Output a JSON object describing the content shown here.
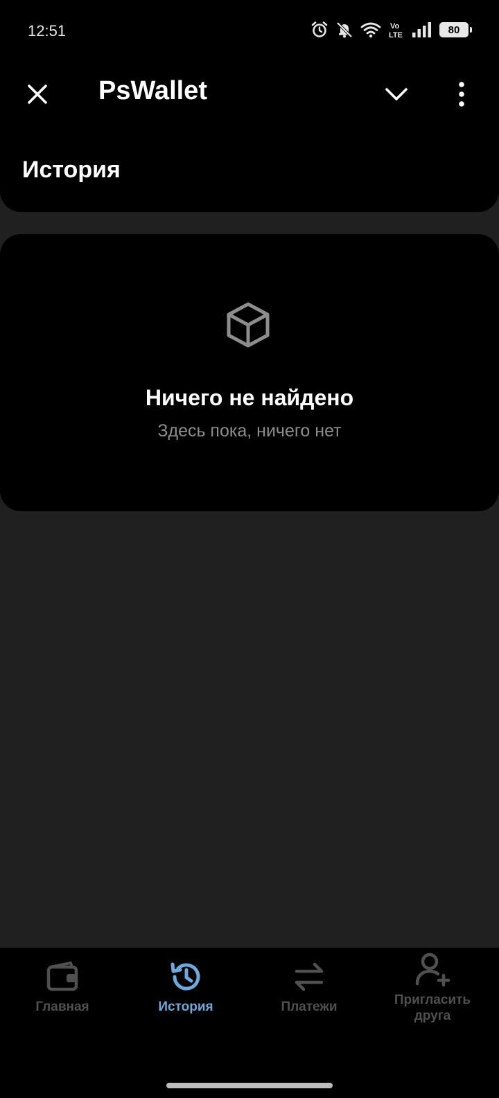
{
  "status_bar": {
    "time": "12:51",
    "icons": [
      "alarm-icon",
      "bell-off-icon",
      "wifi-icon",
      "volte-icon",
      "signal-icon"
    ],
    "battery": "80"
  },
  "header": {
    "close_icon": "close-icon",
    "title": "PsWallet",
    "chevron_icon": "chevron-down-icon",
    "more_icon": "more-vertical-icon",
    "section_title": "История"
  },
  "empty_state": {
    "icon": "cube-icon",
    "title": "Ничего не найдено",
    "subtitle": "Здесь пока, ничего нет"
  },
  "bottom_nav": {
    "active_color": "#6fa8dc",
    "inactive_color": "#505050",
    "items": [
      {
        "label": "Главная",
        "icon": "wallet-icon",
        "active": false
      },
      {
        "label": "История",
        "icon": "history-icon",
        "active": true
      },
      {
        "label": "Платежи",
        "icon": "transfer-icon",
        "active": false
      },
      {
        "label": "Пригласить\nдруга",
        "label_line1": "Пригласить",
        "label_line2": "друга",
        "icon": "add-user-icon",
        "active": false
      }
    ]
  },
  "colors": {
    "background": "#202020",
    "card": "#000000",
    "muted_text": "#8d8d8d"
  }
}
